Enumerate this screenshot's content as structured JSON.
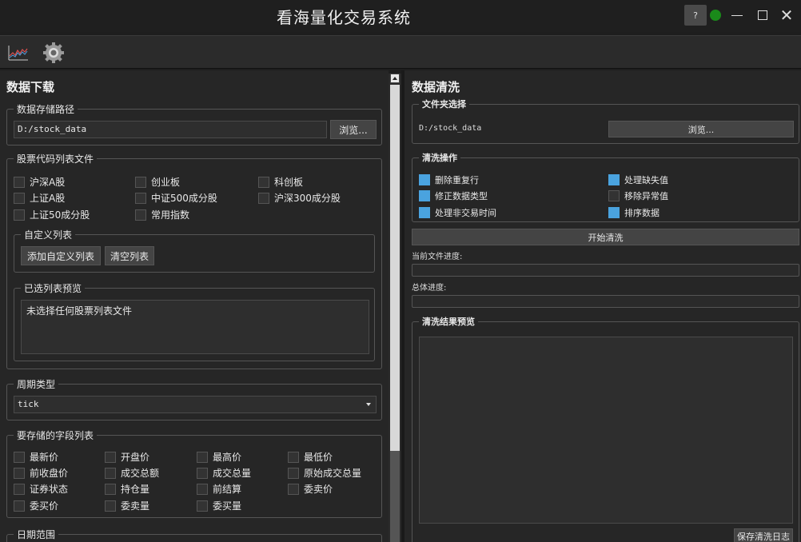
{
  "app": {
    "title": "看海量化交易系统",
    "help_label": "?",
    "status_color": "#1a8a1a",
    "close_glyph": "✕"
  },
  "toolbar": {
    "chart_icon": "line-chart-icon",
    "settings_icon": "gear-icon"
  },
  "download": {
    "title": "数据下载",
    "storage": {
      "title": "数据存储路径",
      "path": "D:/stock_data",
      "browse_label": "浏览..."
    },
    "stock_list": {
      "title": "股票代码列表文件",
      "items": [
        {
          "label": "沪深A股"
        },
        {
          "label": "创业板"
        },
        {
          "label": "科创板"
        },
        {
          "label": "上证A股"
        },
        {
          "label": "中证500成分股"
        },
        {
          "label": "沪深300成分股"
        },
        {
          "label": "上证50成分股"
        },
        {
          "label": "常用指数"
        }
      ],
      "custom": {
        "title": "自定义列表",
        "add_label": "添加自定义列表",
        "clear_label": "清空列表"
      },
      "preview": {
        "title": "已选列表预览",
        "text": "未选择任何股票列表文件"
      }
    },
    "period": {
      "title": "周期类型",
      "value": "tick"
    },
    "fields": {
      "title": "要存储的字段列表",
      "items": [
        {
          "label": "最新价"
        },
        {
          "label": "开盘价"
        },
        {
          "label": "最高价"
        },
        {
          "label": "最低价"
        },
        {
          "label": "前收盘价"
        },
        {
          "label": "成交总额"
        },
        {
          "label": "成交总量"
        },
        {
          "label": "原始成交总量"
        },
        {
          "label": "证券状态"
        },
        {
          "label": "持仓量"
        },
        {
          "label": "前结算"
        },
        {
          "label": "委卖价"
        },
        {
          "label": "委买价"
        },
        {
          "label": "委卖量"
        },
        {
          "label": "委买量"
        }
      ]
    },
    "date_range": {
      "title": "日期范围"
    }
  },
  "clean": {
    "title": "数据清洗",
    "folder": {
      "title": "文件夹选择",
      "path": "D:/stock_data",
      "browse_label": "浏览..."
    },
    "ops": {
      "title": "清洗操作",
      "items": [
        {
          "label": "删除重复行",
          "checked": true
        },
        {
          "label": "处理缺失值",
          "checked": true
        },
        {
          "label": "修正数据类型",
          "checked": true
        },
        {
          "label": "移除异常值",
          "checked": false
        },
        {
          "label": "处理非交易时间",
          "checked": true
        },
        {
          "label": "排序数据",
          "checked": true
        }
      ]
    },
    "start_label": "开始清洗",
    "file_progress_label": "当前文件进度:",
    "total_progress_label": "总体进度:",
    "result": {
      "title": "清洗结果预览",
      "save_log_label": "保存清洗日志"
    },
    "accent_color": "#4aa3df"
  }
}
